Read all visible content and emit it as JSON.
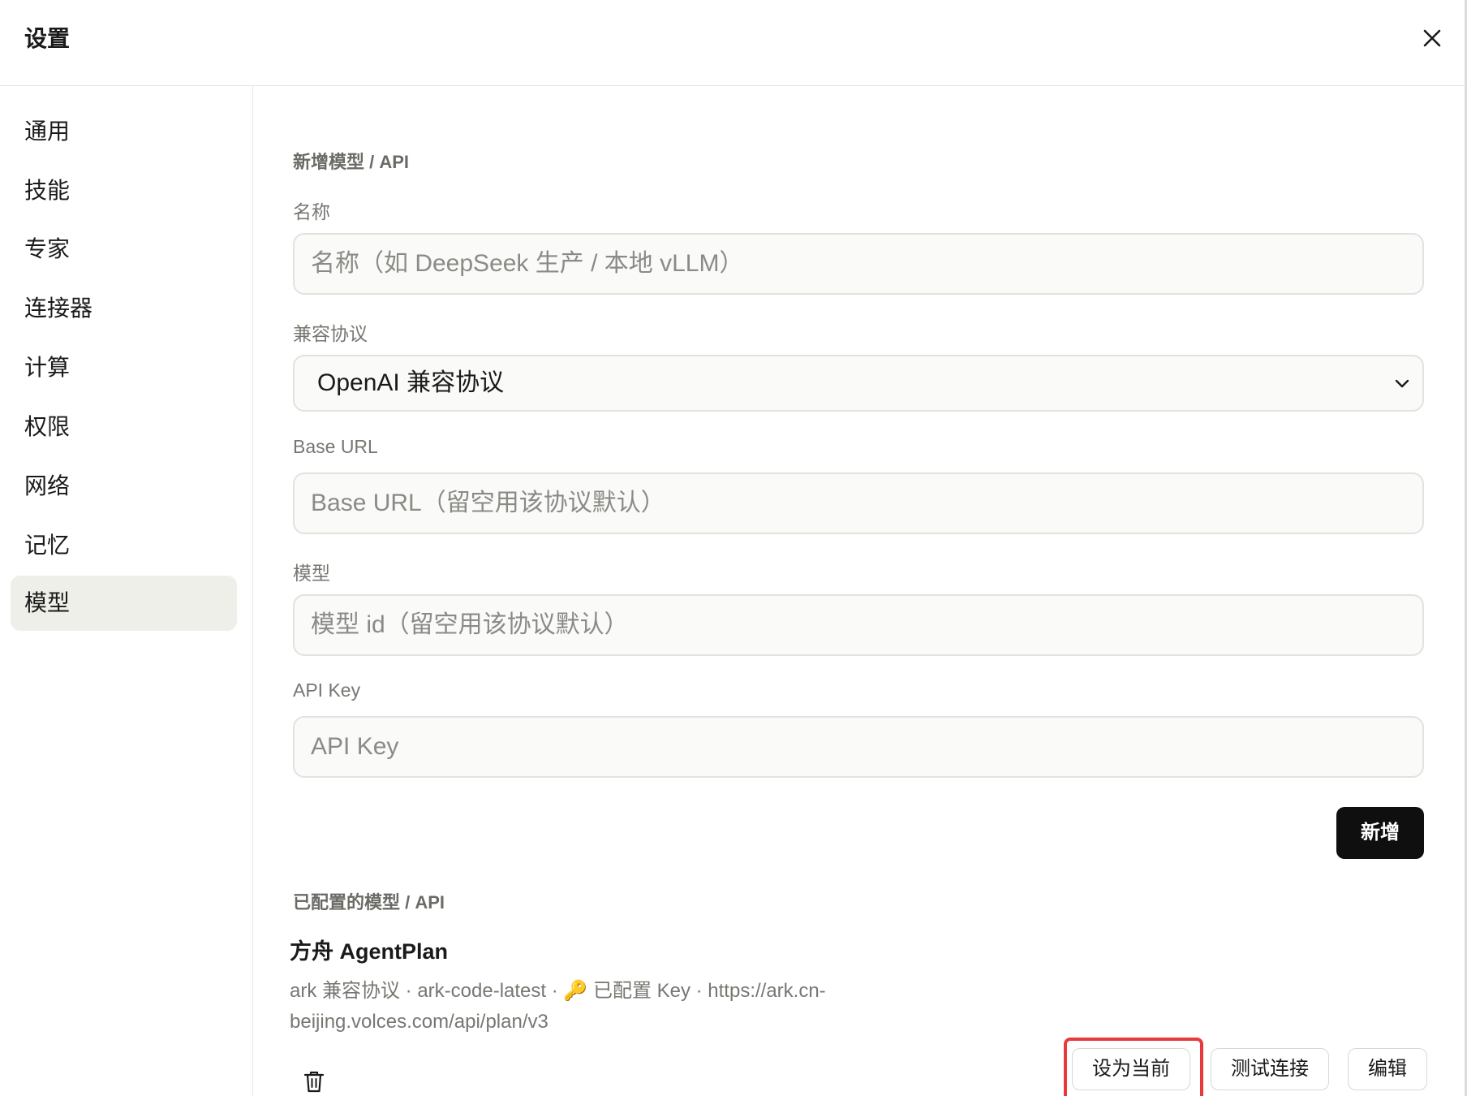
{
  "window": {
    "title": "设置"
  },
  "sidebar": {
    "items": [
      {
        "label": "通用"
      },
      {
        "label": "技能"
      },
      {
        "label": "专家"
      },
      {
        "label": "连接器"
      },
      {
        "label": "计算"
      },
      {
        "label": "权限"
      },
      {
        "label": "网络"
      },
      {
        "label": "记忆"
      },
      {
        "label": "模型",
        "active": true
      }
    ]
  },
  "form": {
    "heading": "新增模型 / API",
    "name": {
      "label": "名称",
      "placeholder": "名称（如 DeepSeek 生产 / 本地 vLLM）",
      "value": ""
    },
    "protocol": {
      "label": "兼容协议",
      "value": "OpenAI 兼容协议"
    },
    "base_url": {
      "label": "Base URL",
      "placeholder": "Base URL（留空用该协议默认）",
      "value": ""
    },
    "model": {
      "label": "模型",
      "placeholder": "模型 id（留空用该协议默认）",
      "value": ""
    },
    "api_key": {
      "label": "API Key",
      "placeholder": "API Key",
      "value": ""
    },
    "add_label": "新增"
  },
  "configured": {
    "heading": "已配置的模型 / API",
    "items": [
      {
        "name": "方舟 AgentPlan",
        "meta": "ark 兼容协议 · ark-code-latest · 🔑 已配置 Key · https://ark.cn-beijing.volces.com/api/plan/v3",
        "actions": {
          "set_current": "设为当前",
          "test": "测试连接",
          "edit": "编辑"
        }
      }
    ]
  },
  "colors": {
    "accent": "#0f0f0f",
    "active_nav_bg": "#efefea",
    "highlight": "#e8393b"
  }
}
